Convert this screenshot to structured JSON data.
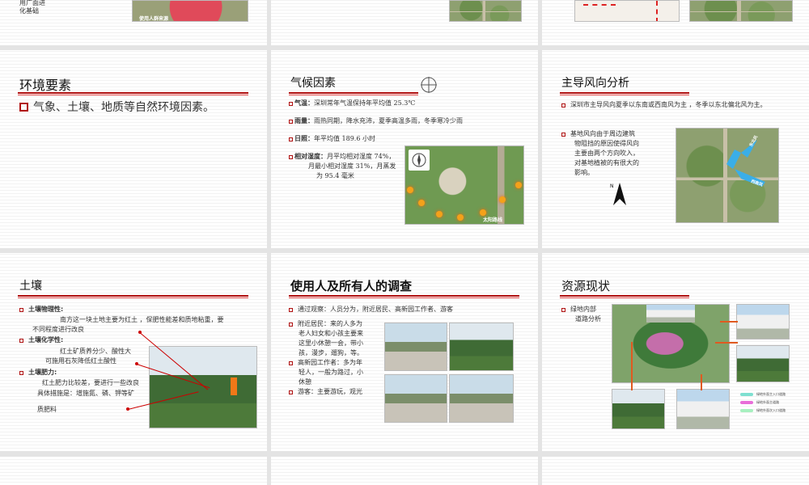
{
  "top_row": {
    "s0_text": "化基础",
    "s0_prefix": "用广面进",
    "s0_caption": "使用人群来源"
  },
  "slide_env": {
    "title": "环境要素",
    "bullet": "气象、土壤、地质等自然环境因素。"
  },
  "slide_climate": {
    "title": "气候因素",
    "items": [
      {
        "label": "气温：",
        "text": "深圳常年气温保持年平均值 25.3℃"
      },
      {
        "label": "雨量：",
        "text": "雨热同期，降水充沛，夏季高温多雨，冬季寒冷少雨"
      },
      {
        "label": "日照：",
        "text": "年平均值 189.6 小时"
      },
      {
        "label": "相对湿度：",
        "text": "月平均相对湿度 74%，"
      }
    ],
    "humidity_line2": "月最小相对湿度 31%，月蒸发",
    "humidity_line3": "为 95.4 毫米",
    "map_caption": "太阳路线"
  },
  "slide_wind": {
    "title": "主导风向分析",
    "para1": "深圳市主导风向夏季以东南或西南风为主 ，冬季以东北偏北风为主。",
    "para2_lines": [
      "基地风向由于周边建筑",
      "物阻挡的原因使得风向",
      "主要由两个方向吹入，",
      "对基地植被的有很大的",
      "影响。"
    ],
    "arrow1": "东北风",
    "arrow2": "西南风"
  },
  "slide_soil": {
    "title": "土壤",
    "phys_label": "土壤物理性:",
    "phys_text1": "南方这一块土地主要为红土 ，保肥性能差和质地粘重，要",
    "phys_text2": "不同程度进行改良",
    "chem_label": "土壤化学性:",
    "chem_text1": "红土矿质养分少、酸性大",
    "chem_text2": "可施用石灰降低红土酸性",
    "fert_label": "土壤肥力:",
    "fert_text1": "红土肥力比较差，要进行一些改良",
    "fert_text2": "具体措施是：增施氮、磷、钾等矿",
    "fert_text3": "质肥料"
  },
  "slide_users": {
    "title": "使用人及所有人的调查",
    "items": [
      "通过观察：人员分为，附近居民、高新园工作者、游客",
      "附近居民：来的人多为",
      "高新园工作者：多为年",
      "游客：主要游玩，观光"
    ],
    "res_lines": [
      "老人妇女和小孩主要来",
      "这里小休憩一会，带小",
      "孩，漫步，遛狗，等。"
    ],
    "work_lines": [
      "轻人，一般为路过，小",
      "休憩"
    ]
  },
  "slide_resources": {
    "title": "资源现状",
    "bullet_line1": "绿地内部",
    "bullet_line2": "道路分析",
    "legend": [
      {
        "label": "绿地外面主入口道路",
        "color": "#7ee0d0"
      },
      {
        "label": "绿地外面主道路",
        "color": "#e86ed8"
      },
      {
        "label": "绿地外面次入口道路",
        "color": "#a8f0c0"
      }
    ]
  }
}
